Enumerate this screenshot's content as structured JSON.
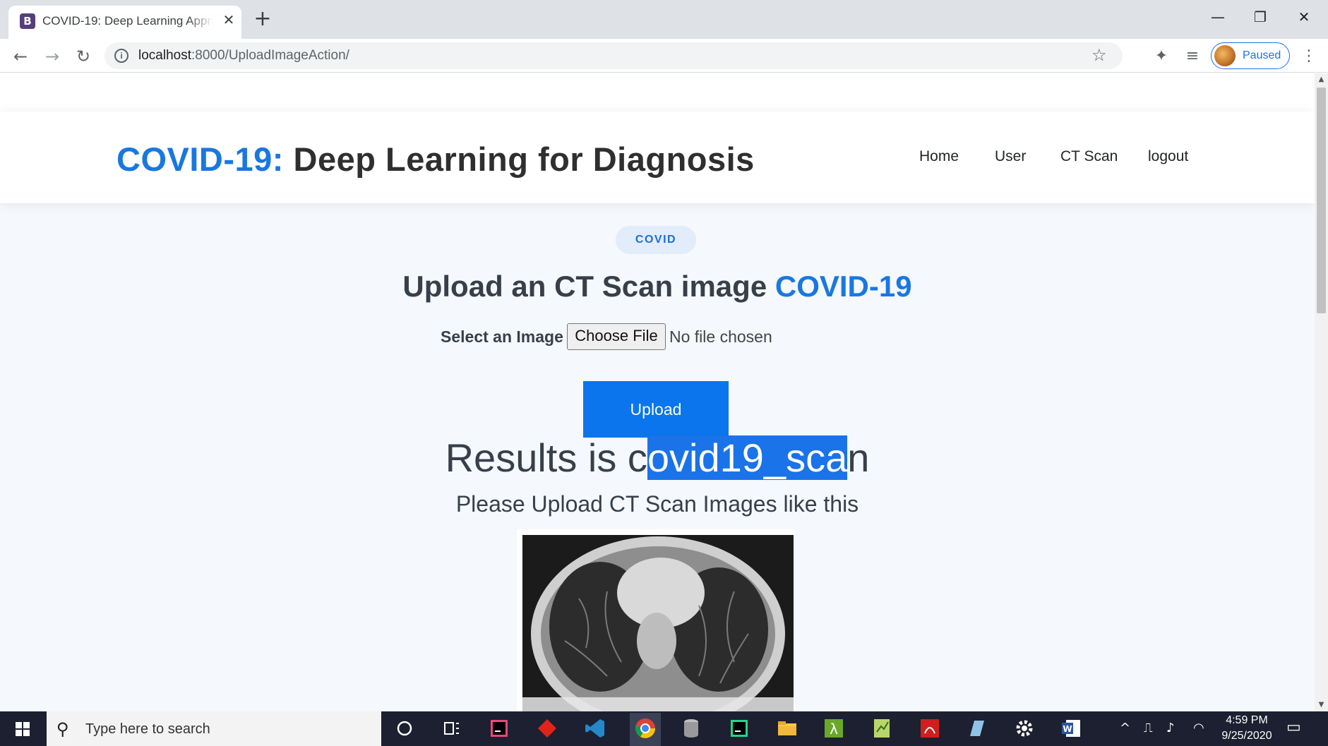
{
  "browser": {
    "tab_title": "COVID-19: Deep Learning Approach",
    "tab_favicon": "B",
    "url_host": "localhost",
    "url_path": ":8000/UploadImageAction/",
    "profile_label": "Paused"
  },
  "site": {
    "brand_accent": "COVID-19:",
    "brand_rest": " Deep Learning for Diagnosis",
    "nav": [
      "Home",
      "User",
      "CT Scan",
      "logout"
    ]
  },
  "main": {
    "badge": "COVID",
    "heading_prefix": "Upload an CT Scan image ",
    "heading_accent": "COVID-19",
    "upload_label": "Select an Image",
    "choose_file": "Choose File",
    "no_file": "No file chosen",
    "upload_button": "Upload",
    "results_before": "Results is c",
    "results_selected": "ovid19_sca",
    "results_after": "n",
    "subheading": "Please Upload CT Scan Images like this"
  },
  "taskbar": {
    "search_placeholder": "Type here to search",
    "time": "4:59 PM",
    "date": "9/25/2020"
  },
  "colors": {
    "accent": "#1977e2",
    "button": "#0a75ec",
    "selection": "#1a73e8",
    "taskbar": "#1c2030"
  }
}
